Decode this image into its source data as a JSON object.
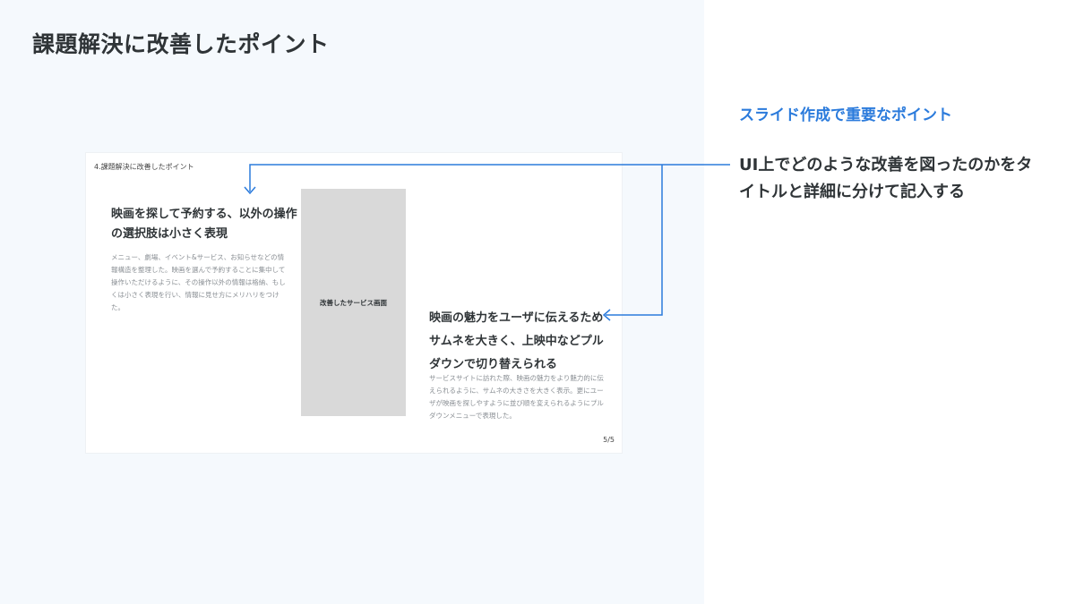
{
  "page": {
    "title": "課題解決に改善したポイント"
  },
  "slide": {
    "header": "4.課題解決に改善したポイント",
    "point1": {
      "title": "映画を探して予約する、以外の操作の選択肢は小さく表現",
      "body": "メニュー、劇場、イベント&サービス、お知らせなどの情報構造を整理した。映画を選んで予約することに集中して操作いただけるように、その操作以外の情報は格納、もしくは小さく表現を行い、情報に見せ方にメリハリをつけた。"
    },
    "placeholder_label": "改善したサービス画面",
    "point2": {
      "title": "映画の魅力をユーザに伝えるためサムネを大きく、上映中などプルダウンで切り替えられる",
      "body": "サービスサイトに訪れた際、映画の魅力をより魅力的に伝えられるように、サムネの大きさを大きく表示。更にユーザが映画を探しやすように並び順を変えられるようにプルダウンメニューで表現した。"
    },
    "page_number": "5/5"
  },
  "note": {
    "heading": "スライド作成で重要なポイント",
    "body": "UI上でどのような改善を図ったのかをタイトルと詳細に分けて記入する"
  },
  "colors": {
    "accent": "#2b7bdc",
    "left_background": "#f5f9fd",
    "text": "#2f3437",
    "muted_text": "#8a8f94",
    "placeholder": "#d9d9d9"
  }
}
